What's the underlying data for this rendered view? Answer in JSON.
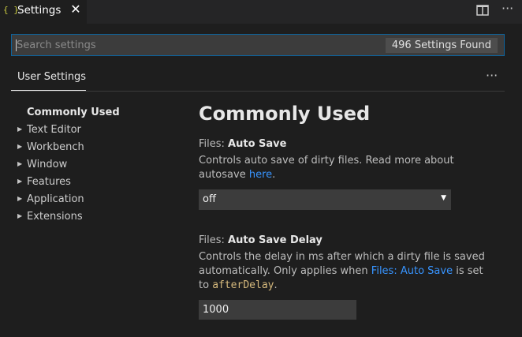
{
  "tab": {
    "icon": "{ }",
    "title": "Settings",
    "close": "✕"
  },
  "editor_actions": {
    "split_icon": "split-editor-icon",
    "more": "···"
  },
  "search": {
    "placeholder": "Search settings",
    "value": "",
    "count": "496 Settings Found"
  },
  "scope": {
    "label": "User Settings",
    "more": "···"
  },
  "toc": {
    "items": [
      {
        "label": "Commonly Used",
        "expandable": false,
        "active": true
      },
      {
        "label": "Text Editor",
        "expandable": true
      },
      {
        "label": "Workbench",
        "expandable": true
      },
      {
        "label": "Window",
        "expandable": true
      },
      {
        "label": "Features",
        "expandable": true
      },
      {
        "label": "Application",
        "expandable": true
      },
      {
        "label": "Extensions",
        "expandable": true
      }
    ]
  },
  "content": {
    "heading": "Commonly Used",
    "autosave": {
      "category": "Files: ",
      "name": "Auto Save",
      "desc_prefix": "Controls auto save of dirty files. Read more about autosave",
      "desc_link": "here",
      "desc_suffix": ".",
      "value": "off"
    },
    "autosave_delay": {
      "category": "Files: ",
      "name": "Auto Save Delay",
      "desc_prefix": "Controls the delay in ms after which a dirty file is saved automatically. Only applies when",
      "desc_link": "Files: Auto Save",
      "desc_middle": "is set to",
      "desc_code": "afterDelay",
      "desc_suffix": ".",
      "value": "1000"
    }
  },
  "colors": {
    "accent": "#0e639c",
    "link": "#3794ff",
    "code": "#d7ba7d",
    "background": "#1e1e1e"
  }
}
